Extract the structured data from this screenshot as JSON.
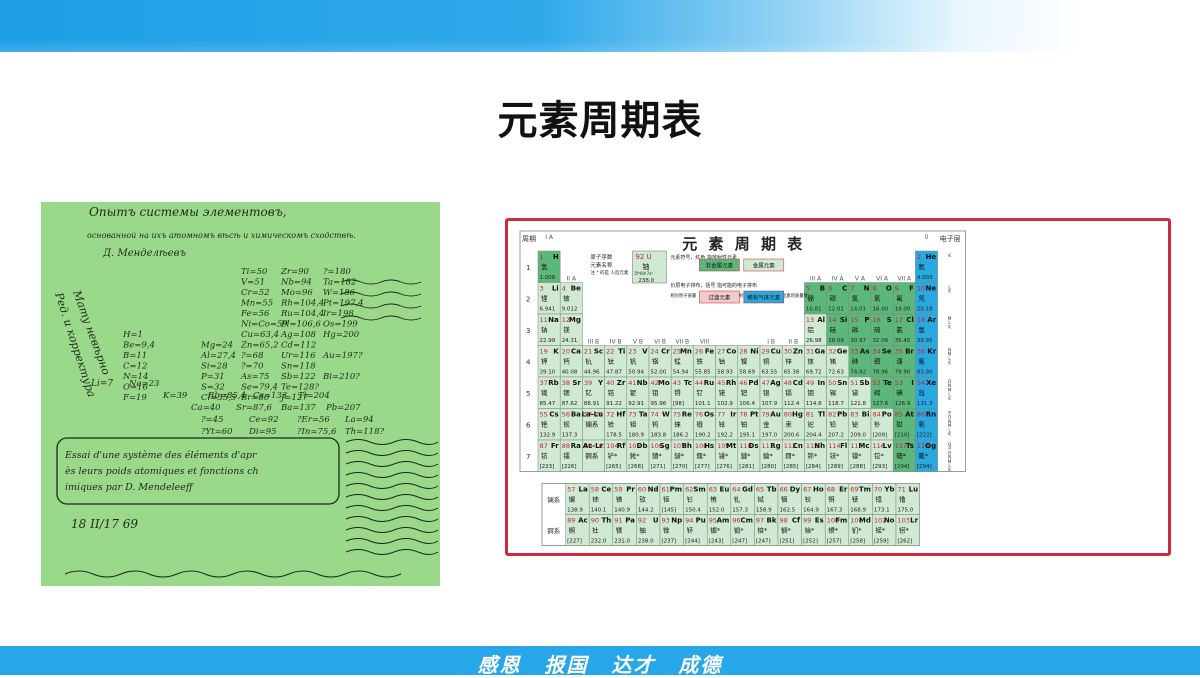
{
  "slide": {
    "title": "元素周期表",
    "motto": "感恩  报国  达才  成德"
  },
  "manuscript": {
    "handwritten_lines": [
      "Опытъ системы элементовъ,",
      "основанной на ихъ атомномъ вѣсѣ и химическомъ сходствѣ.",
      "Д. Менделѣевъ",
      "Ti=50",
      "Zr=90",
      "?=180",
      "V=51",
      "Nb=94",
      "Ta=182",
      "Cr=52",
      "Mo=96",
      "W=186",
      "Mn=55",
      "Rh=104,4",
      "Pt=197,4",
      "Fe=56",
      "Ru=104,4",
      "Ir=198",
      "Ni=Co=59",
      "Pl=106,6",
      "Os=199",
      "H=1",
      "Cu=63,4",
      "Ag=108",
      "Hg=200",
      "Be=9,4",
      "Mg=24",
      "Zn=65,2",
      "Cd=112",
      "B=11",
      "Al=27,4",
      "?=68",
      "Ur=116",
      "Au=197?",
      "C=12",
      "Si=28",
      "?=70",
      "Sn=118",
      "N=14",
      "P=31",
      "As=75",
      "Sb=122",
      "Bi=210?",
      "O=16",
      "S=32",
      "Se=79,4",
      "Te=128?",
      "F=19",
      "Cl=35,5",
      "Br=80",
      "J=127",
      "Li=7",
      "Na=23",
      "K=39",
      "Rb=85,4",
      "Cs=133",
      "Tl=204",
      "Ca=40",
      "Sr=87,6",
      "Ba=137",
      "Pb=207",
      "?=45",
      "Ce=92",
      "?Er=56",
      "La=94",
      "?Yt=60",
      "Di=95",
      "?In=75,6",
      "Th=118?",
      "Essai d'une système des éléments d'après leurs poids atomiques et fonctions chimiques par D. Mendeleeff",
      "18 II/17 69"
    ]
  },
  "periodic_table": {
    "title": "元 素 周 期 表",
    "header_left": "周期",
    "header_right": "电子层",
    "group_labels": [
      "I A",
      "II A",
      "III A",
      "IV A",
      "V A",
      "VI A",
      "VII A",
      "0",
      "III B",
      "IV B",
      "V B",
      "VI B",
      "VII B",
      "VIII",
      "I B",
      "II B"
    ],
    "group_numbers": [
      "1",
      "2",
      "3",
      "4",
      "5",
      "6",
      "7",
      "8",
      "9",
      "10",
      "11",
      "12",
      "13",
      "14",
      "15",
      "16",
      "17",
      "18"
    ],
    "period_numbers": [
      "1",
      "2",
      "3",
      "4",
      "5",
      "6",
      "7"
    ],
    "legend": {
      "sample_number": "92 U",
      "sample_name": "铀",
      "sample_config": "5f³6d¹7s²",
      "sample_mass": "238.0",
      "label_number": "原子序数",
      "label_name": "元素名称",
      "label_note": "注 * 的是 人造元素",
      "label_symbol": "元素符号，红色 指放射性元素",
      "label_config": "价层电子排布，括号 指可能的电子排布",
      "label_mass": "相对原子质量（加括号的数据为该放射性元素半衰期最长同位素的质量数）",
      "nonmetal": "非金属元素",
      "metal": "金属元素",
      "transition": "过渡元素",
      "noble": "稀有气体元素"
    },
    "shells": [
      [
        "K"
      ],
      [
        "L",
        "K"
      ],
      [
        "M",
        "L",
        "K"
      ],
      [
        "N",
        "M",
        "L",
        "K"
      ],
      [
        "O",
        "N",
        "M",
        "L",
        "K"
      ],
      [
        "P",
        "O",
        "N",
        "M",
        "L",
        "K"
      ],
      [
        "Q",
        "P",
        "O",
        "N",
        "M",
        "L",
        "K"
      ]
    ],
    "rows": [
      [
        [
          "1",
          "H",
          "氢",
          "1.008",
          0
        ],
        [
          "2",
          "He",
          "氦",
          "4.003",
          17
        ]
      ],
      [
        [
          "3",
          "Li",
          "锂",
          "6.941",
          0
        ],
        [
          "4",
          "Be",
          "铍",
          "9.012",
          1
        ],
        [
          "5",
          "B",
          "硼",
          "10.81",
          12
        ],
        [
          "6",
          "C",
          "碳",
          "12.01",
          13
        ],
        [
          "7",
          "N",
          "氮",
          "14.01",
          14
        ],
        [
          "8",
          "O",
          "氧",
          "16.00",
          15
        ],
        [
          "9",
          "F",
          "氟",
          "19.00",
          16
        ],
        [
          "10",
          "Ne",
          "氖",
          "20.18",
          17
        ]
      ],
      [
        [
          "11",
          "Na",
          "钠",
          "22.99",
          0
        ],
        [
          "12",
          "Mg",
          "镁",
          "24.31",
          1
        ],
        [
          "13",
          "Al",
          "铝",
          "26.98",
          12
        ],
        [
          "14",
          "Si",
          "硅",
          "28.09",
          13
        ],
        [
          "15",
          "P",
          "磷",
          "30.97",
          14
        ],
        [
          "16",
          "S",
          "硫",
          "32.06",
          15
        ],
        [
          "17",
          "Cl",
          "氯",
          "35.45",
          16
        ],
        [
          "18",
          "Ar",
          "氩",
          "39.95",
          17
        ]
      ],
      [
        [
          "19",
          "K",
          "钾",
          "39.10",
          0
        ],
        [
          "20",
          "Ca",
          "钙",
          "40.08",
          1
        ],
        [
          "21",
          "Sc",
          "钪",
          "44.96",
          2
        ],
        [
          "22",
          "Ti",
          "钛",
          "47.87",
          3
        ],
        [
          "23",
          "V",
          "钒",
          "50.94",
          4
        ],
        [
          "24",
          "Cr",
          "铬",
          "52.00",
          5
        ],
        [
          "25",
          "Mn",
          "锰",
          "54.94",
          6
        ],
        [
          "26",
          "Fe",
          "铁",
          "55.85",
          7
        ],
        [
          "27",
          "Co",
          "钴",
          "58.93",
          8
        ],
        [
          "28",
          "Ni",
          "镍",
          "58.69",
          9
        ],
        [
          "29",
          "Cu",
          "铜",
          "63.55",
          10
        ],
        [
          "30",
          "Zn",
          "锌",
          "65.38",
          11
        ],
        [
          "31",
          "Ga",
          "镓",
          "69.72",
          12
        ],
        [
          "32",
          "Ge",
          "锗",
          "72.63",
          13
        ],
        [
          "33",
          "As",
          "砷",
          "74.92",
          14
        ],
        [
          "34",
          "Se",
          "硒",
          "78.96",
          15
        ],
        [
          "35",
          "Br",
          "溴",
          "79.90",
          16
        ],
        [
          "36",
          "Kr",
          "氪",
          "83.80",
          17
        ]
      ],
      [
        [
          "37",
          "Rb",
          "铷",
          "85.47",
          0
        ],
        [
          "38",
          "Sr",
          "锶",
          "87.62",
          1
        ],
        [
          "39",
          "Y",
          "钇",
          "88.91",
          2
        ],
        [
          "40",
          "Zr",
          "锆",
          "91.22",
          3
        ],
        [
          "41",
          "Nb",
          "铌",
          "92.91",
          4
        ],
        [
          "42",
          "Mo",
          "钼",
          "95.96",
          5
        ],
        [
          "43",
          "Tc",
          "锝",
          "[98]",
          6
        ],
        [
          "44",
          "Ru",
          "钌",
          "101.1",
          7
        ],
        [
          "45",
          "Rh",
          "铑",
          "102.9",
          8
        ],
        [
          "46",
          "Pd",
          "钯",
          "106.4",
          9
        ],
        [
          "47",
          "Ag",
          "银",
          "107.9",
          10
        ],
        [
          "48",
          "Cd",
          "镉",
          "112.4",
          11
        ],
        [
          "49",
          "In",
          "铟",
          "114.8",
          12
        ],
        [
          "50",
          "Sn",
          "锡",
          "118.7",
          13
        ],
        [
          "51",
          "Sb",
          "锑",
          "121.8",
          14
        ],
        [
          "52",
          "Te",
          "碲",
          "127.6",
          15
        ],
        [
          "53",
          "I",
          "碘",
          "126.9",
          16
        ],
        [
          "54",
          "Xe",
          "氙",
          "131.3",
          17
        ]
      ],
      [
        [
          "55",
          "Cs",
          "铯",
          "132.9",
          0
        ],
        [
          "56",
          "Ba",
          "钡",
          "137.3",
          1
        ],
        [
          "57-71",
          "La-Lu",
          "镧系",
          "",
          2
        ],
        [
          "72",
          "Hf",
          "铪",
          "178.5",
          3
        ],
        [
          "73",
          "Ta",
          "钽",
          "180.9",
          4
        ],
        [
          "74",
          "W",
          "钨",
          "183.8",
          5
        ],
        [
          "75",
          "Re",
          "铼",
          "186.2",
          6
        ],
        [
          "76",
          "Os",
          "锇",
          "190.2",
          7
        ],
        [
          "77",
          "Ir",
          "铱",
          "192.2",
          8
        ],
        [
          "78",
          "Pt",
          "铂",
          "195.1",
          9
        ],
        [
          "79",
          "Au",
          "金",
          "197.0",
          10
        ],
        [
          "80",
          "Hg",
          "汞",
          "200.6",
          11
        ],
        [
          "81",
          "Tl",
          "铊",
          "204.4",
          12
        ],
        [
          "82",
          "Pb",
          "铅",
          "207.2",
          13
        ],
        [
          "83",
          "Bi",
          "铋",
          "209.0",
          14
        ],
        [
          "84",
          "Po",
          "钋",
          "[209]",
          15
        ],
        [
          "85",
          "At",
          "砹",
          "[210]",
          16
        ],
        [
          "86",
          "Rn",
          "氡",
          "[222]",
          17
        ]
      ],
      [
        [
          "87",
          "Fr",
          "钫",
          "[223]",
          0
        ],
        [
          "88",
          "Ra",
          "镭",
          "[226]",
          1
        ],
        [
          "89-103",
          "Ac-Lr",
          "锕系",
          "",
          2
        ],
        [
          "104",
          "Rf",
          "铲*",
          "[265]",
          3
        ],
        [
          "105",
          "Db",
          "𨧀*",
          "[268]",
          4
        ],
        [
          "106",
          "Sg",
          "𨭎*",
          "[271]",
          5
        ],
        [
          "107",
          "Bh",
          "𨨏*",
          "[270]",
          6
        ],
        [
          "108",
          "Hs",
          "𨭆*",
          "[277]",
          7
        ],
        [
          "109",
          "Mt",
          "鿏*",
          "[276]",
          8
        ],
        [
          "110",
          "Ds",
          "鐽*",
          "[281]",
          9
        ],
        [
          "111",
          "Rg",
          "錀*",
          "[280]",
          10
        ],
        [
          "112",
          "Cn",
          "鎶*",
          "[285]",
          11
        ],
        [
          "113",
          "Nh",
          "鿭*",
          "[284]",
          12
        ],
        [
          "114",
          "Fl",
          "𫓧*",
          "[289]",
          13
        ],
        [
          "115",
          "Mc",
          "镆*",
          "[288]",
          14
        ],
        [
          "116",
          "Lv",
          "𫟷*",
          "[293]",
          15
        ],
        [
          "117",
          "Ts",
          "鿬*",
          "[294]",
          16
        ],
        [
          "118",
          "Og",
          "鿫*",
          "[294]",
          17
        ]
      ]
    ],
    "lanthanides_label": "镧系",
    "actinides_label": "锕系",
    "lanthanides": [
      [
        "57",
        "La",
        "镧",
        "138.9"
      ],
      [
        "58",
        "Ce",
        "铈",
        "140.1"
      ],
      [
        "59",
        "Pr",
        "镨",
        "140.9"
      ],
      [
        "60",
        "Nd",
        "钕",
        "144.2"
      ],
      [
        "61",
        "Pm",
        "钷",
        "[145]"
      ],
      [
        "62",
        "Sm",
        "钐",
        "150.4"
      ],
      [
        "63",
        "Eu",
        "铕",
        "152.0"
      ],
      [
        "64",
        "Gd",
        "钆",
        "157.3"
      ],
      [
        "65",
        "Tb",
        "铽",
        "158.9"
      ],
      [
        "66",
        "Dy",
        "镝",
        "162.5"
      ],
      [
        "67",
        "Ho",
        "钬",
        "164.9"
      ],
      [
        "68",
        "Er",
        "铒",
        "167.3"
      ],
      [
        "69",
        "Tm",
        "铥",
        "168.9"
      ],
      [
        "70",
        "Yb",
        "镱",
        "173.1"
      ],
      [
        "71",
        "Lu",
        "镥",
        "175.0"
      ]
    ],
    "actinides": [
      [
        "89",
        "Ac",
        "锕",
        "[227]"
      ],
      [
        "90",
        "Th",
        "钍",
        "232.0"
      ],
      [
        "91",
        "Pa",
        "镤",
        "231.0"
      ],
      [
        "92",
        "U",
        "铀",
        "238.0"
      ],
      [
        "93",
        "Np",
        "镎",
        "[237]"
      ],
      [
        "94",
        "Pu",
        "钚",
        "[244]"
      ],
      [
        "95",
        "Am",
        "镅*",
        "[243]"
      ],
      [
        "96",
        "Cm",
        "锔*",
        "[247]"
      ],
      [
        "97",
        "Bk",
        "锫*",
        "[247]"
      ],
      [
        "98",
        "Cf",
        "锎*",
        "[251]"
      ],
      [
        "99",
        "Es",
        "锿*",
        "[252]"
      ],
      [
        "100",
        "Fm",
        "镄*",
        "[257]"
      ],
      [
        "101",
        "Md",
        "钔*",
        "[258]"
      ],
      [
        "102",
        "No",
        "锘*",
        "[259]"
      ],
      [
        "103",
        "Lr",
        "铹*",
        "[262]"
      ]
    ]
  },
  "colors": {
    "top_band": "#1f9ee6",
    "bottom_band": "#27a7e7",
    "manuscript_bg": "#9ad88a",
    "frame_border": "#d1293e",
    "nonmetal": "#5cb87a",
    "metal": "#cfe9d3",
    "noble": "#2aa8e0",
    "transition": "#f4c9c9",
    "table_line": "#7a8a7e"
  }
}
